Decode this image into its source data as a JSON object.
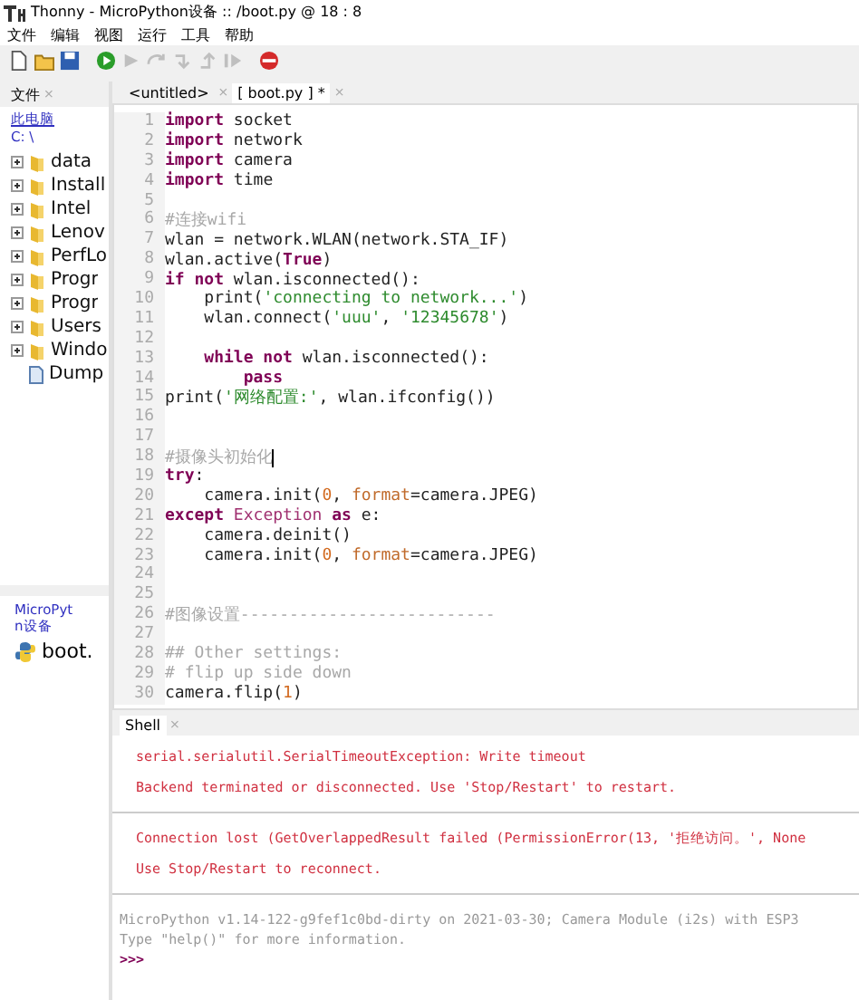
{
  "window": {
    "title": "Thonny  -  MicroPython设备 :: /boot.py  @  18 : 8"
  },
  "menu": [
    "文件",
    "编辑",
    "视图",
    "运行",
    "工具",
    "帮助"
  ],
  "toolbar": [
    {
      "kind": "new",
      "disabled": false
    },
    {
      "kind": "open",
      "disabled": false
    },
    {
      "kind": "save",
      "disabled": false
    },
    {
      "kind": "run",
      "disabled": false
    },
    {
      "kind": "debug",
      "disabled": true
    },
    {
      "kind": "step-over",
      "disabled": true
    },
    {
      "kind": "step-into",
      "disabled": true
    },
    {
      "kind": "step-out",
      "disabled": true
    },
    {
      "kind": "resume",
      "disabled": true
    },
    {
      "kind": "stop",
      "disabled": false
    }
  ],
  "files_panel": {
    "tab": "文件",
    "close": "×",
    "computer": "此电脑",
    "path": "C: \\",
    "items": [
      {
        "kind": "folder",
        "label": "data",
        "expanded": false
      },
      {
        "kind": "folder",
        "label": "Install",
        "expanded": false
      },
      {
        "kind": "folder",
        "label": "Intel",
        "expanded": false
      },
      {
        "kind": "folder",
        "label": "Lenov",
        "expanded": false
      },
      {
        "kind": "folder",
        "label": "PerfLo",
        "expanded": false
      },
      {
        "kind": "folder",
        "label": "Progr",
        "expanded": false
      },
      {
        "kind": "folder",
        "label": "Progr",
        "expanded": false
      },
      {
        "kind": "folder",
        "label": "Users",
        "expanded": false
      },
      {
        "kind": "folder",
        "label": "Windo",
        "expanded": false
      },
      {
        "kind": "file",
        "label": "Dump"
      }
    ]
  },
  "device_panel": {
    "title_lines": [
      "MicroPyt",
      "n设备"
    ],
    "files": [
      {
        "label": "boot."
      }
    ]
  },
  "editor_tabs": [
    {
      "label": "<untitled>",
      "close": "×",
      "selected": false
    },
    {
      "label": "[ boot.py ] *",
      "close": "×",
      "selected": true
    }
  ],
  "code_lines": [
    {
      "no": "1",
      "tokens": [
        {
          "kind": "kw",
          "text": "import"
        },
        {
          "kind": "plain",
          "text": " socket"
        }
      ]
    },
    {
      "no": "2",
      "tokens": [
        {
          "kind": "kw",
          "text": "import"
        },
        {
          "kind": "plain",
          "text": " network"
        }
      ]
    },
    {
      "no": "3",
      "tokens": [
        {
          "kind": "kw",
          "text": "import"
        },
        {
          "kind": "plain",
          "text": " camera"
        }
      ]
    },
    {
      "no": "4",
      "tokens": [
        {
          "kind": "kw",
          "text": "import"
        },
        {
          "kind": "plain",
          "text": " time"
        }
      ]
    },
    {
      "no": "5"
    },
    {
      "no": "6",
      "tokens": [
        {
          "kind": "comment",
          "text": "#连接wifi"
        }
      ]
    },
    {
      "no": "7",
      "tokens": [
        {
          "kind": "plain",
          "text": "wlan = network.WLAN(network.STA_IF)"
        }
      ]
    },
    {
      "no": "8",
      "tokens": [
        {
          "kind": "plain",
          "text": "wlan.active("
        },
        {
          "kind": "kw",
          "text": "True"
        },
        {
          "kind": "plain",
          "text": ")"
        }
      ]
    },
    {
      "no": "9",
      "tokens": [
        {
          "kind": "kw",
          "text": "if not"
        },
        {
          "kind": "plain",
          "text": " wlan.isconnected():"
        }
      ]
    },
    {
      "no": "10",
      "tokens": [
        {
          "kind": "plain",
          "text": "    print("
        },
        {
          "kind": "string",
          "text": "'connecting to network...'"
        },
        {
          "kind": "plain",
          "text": ")"
        }
      ]
    },
    {
      "no": "11",
      "tokens": [
        {
          "kind": "plain",
          "text": "    wlan.connect("
        },
        {
          "kind": "string",
          "text": "'uuu'"
        },
        {
          "kind": "plain",
          "text": ", "
        },
        {
          "kind": "string",
          "text": "'12345678'"
        },
        {
          "kind": "plain",
          "text": ")"
        }
      ]
    },
    {
      "no": "12"
    },
    {
      "no": "13",
      "tokens": [
        {
          "kind": "kw",
          "text": "    while not"
        },
        {
          "kind": "plain",
          "text": " wlan.isconnected():"
        }
      ]
    },
    {
      "no": "14",
      "tokens": [
        {
          "kind": "kw",
          "text": "        pass"
        }
      ]
    },
    {
      "no": "15",
      "tokens": [
        {
          "kind": "plain",
          "text": "print("
        },
        {
          "kind": "string",
          "text": "'网络配置:'"
        },
        {
          "kind": "plain",
          "text": ", wlan.ifconfig())"
        }
      ]
    },
    {
      "no": "16"
    },
    {
      "no": "17"
    },
    {
      "no": "18",
      "tokens": [
        {
          "kind": "comment",
          "text": "#摄像头初始化"
        }
      ],
      "cursor": true
    },
    {
      "no": "19",
      "tokens": [
        {
          "kind": "kw",
          "text": "try"
        },
        {
          "kind": "plain",
          "text": ":"
        }
      ]
    },
    {
      "no": "20",
      "tokens": [
        {
          "kind": "plain",
          "text": "    camera.init("
        },
        {
          "kind": "number",
          "text": "0"
        },
        {
          "kind": "plain",
          "text": ", "
        },
        {
          "kind": "param",
          "text": "format"
        },
        {
          "kind": "plain",
          "text": "=camera.JPEG)"
        }
      ]
    },
    {
      "no": "21",
      "tokens": [
        {
          "kind": "kw",
          "text": "except"
        },
        {
          "kind": "builtin",
          "text": " Exception "
        },
        {
          "kind": "kw",
          "text": "as"
        },
        {
          "kind": "plain",
          "text": " e:"
        }
      ]
    },
    {
      "no": "22",
      "tokens": [
        {
          "kind": "plain",
          "text": "    camera.deinit()"
        }
      ]
    },
    {
      "no": "23",
      "tokens": [
        {
          "kind": "plain",
          "text": "    camera.init("
        },
        {
          "kind": "number",
          "text": "0"
        },
        {
          "kind": "plain",
          "text": ", "
        },
        {
          "kind": "param",
          "text": "format"
        },
        {
          "kind": "plain",
          "text": "=camera.JPEG)"
        }
      ]
    },
    {
      "no": "24"
    },
    {
      "no": "25"
    },
    {
      "no": "26",
      "tokens": [
        {
          "kind": "comment",
          "text": "#图像设置--------------------------"
        }
      ]
    },
    {
      "no": "27"
    },
    {
      "no": "28",
      "tokens": [
        {
          "kind": "comment",
          "text": "## Other settings:"
        }
      ]
    },
    {
      "no": "29",
      "tokens": [
        {
          "kind": "comment",
          "text": "# flip up side down"
        }
      ]
    },
    {
      "no": "30",
      "tokens": [
        {
          "kind": "plain",
          "text": "camera.flip("
        },
        {
          "kind": "number",
          "text": "1"
        },
        {
          "kind": "plain",
          "text": ")"
        }
      ]
    }
  ],
  "shell": {
    "tab": "Shell",
    "close": "×",
    "lines": [
      {
        "kind": "error",
        "text": "serial.serialutil.SerialTimeoutException: Write timeout"
      },
      {
        "kind": "error",
        "text": "Backend terminated or disconnected. Use 'Stop/Restart' to restart."
      },
      {
        "kind": "separator"
      },
      {
        "kind": "error",
        "text": "Connection lost (GetOverlappedResult failed (PermissionError(13, '拒绝访问。', None"
      },
      {
        "kind": "error",
        "text": "Use Stop/Restart to reconnect."
      },
      {
        "kind": "separator"
      },
      {
        "kind": "info",
        "text": "MicroPython v1.14-122-g9fef1c0bd-dirty on 2021-03-30; Camera Module (i2s) with ESP3"
      },
      {
        "kind": "info",
        "text": "Type \"help()\" for more information."
      },
      {
        "kind": "prompt",
        "text": ">>>"
      }
    ]
  }
}
